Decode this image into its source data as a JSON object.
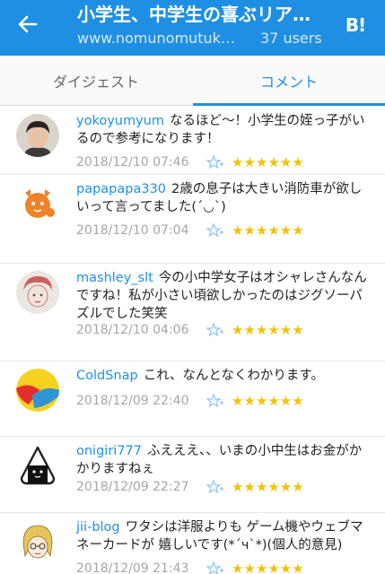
{
  "header": {
    "title": "小学生、中学生の喜ぶリア…",
    "url": "www.nomunomutuk…",
    "users": "37 users",
    "logo": "B!"
  },
  "tabs": [
    {
      "label": "ダイジェスト",
      "active": false
    },
    {
      "label": "コメント",
      "active": true
    }
  ],
  "colors": {
    "brand": "#1f8fe3",
    "star": "#f3c200"
  },
  "comments": [
    {
      "user": "yokoyumyum",
      "text": "なるほど〜！小学生の姪っ子がいるので参考になります！",
      "date": "2018/12/10 07:46",
      "stars": "★★★★★★",
      "star_count": 6
    },
    {
      "user": "papapapa330",
      "text": "2歳の息子は大きい消防車が欲しいって言ってました(´◡`)",
      "date": "2018/12/10 07:04",
      "stars": "★★★★★★",
      "star_count": 6
    },
    {
      "user": "mashley_slt",
      "text": "今の小中学女子はオシャレさんなんですね！私が小さい頃欲しかったのはジグソーパズルでした笑笑",
      "date": "2018/12/10 04:06",
      "stars": "★★★★★★",
      "star_count": 6
    },
    {
      "user": "ColdSnap",
      "text": "これ、なんとなくわかります。",
      "date": "2018/12/09 22:40",
      "stars": "★★★★★★",
      "star_count": 6
    },
    {
      "user": "onigiri777",
      "text": "ふえええ、、いまの小中生はお金がかかりますねぇ",
      "date": "2018/12/09 22:27",
      "stars": "★★★★★★",
      "star_count": 6
    },
    {
      "user": "jii-blog",
      "text": "ワタシは洋服よりも ゲーム機やウェブマネーカードが 嬉しいです(*´ч`*)(個人的意見)",
      "date": "2018/12/09 21:43",
      "stars": "★★★★★★",
      "star_count": 6
    }
  ]
}
